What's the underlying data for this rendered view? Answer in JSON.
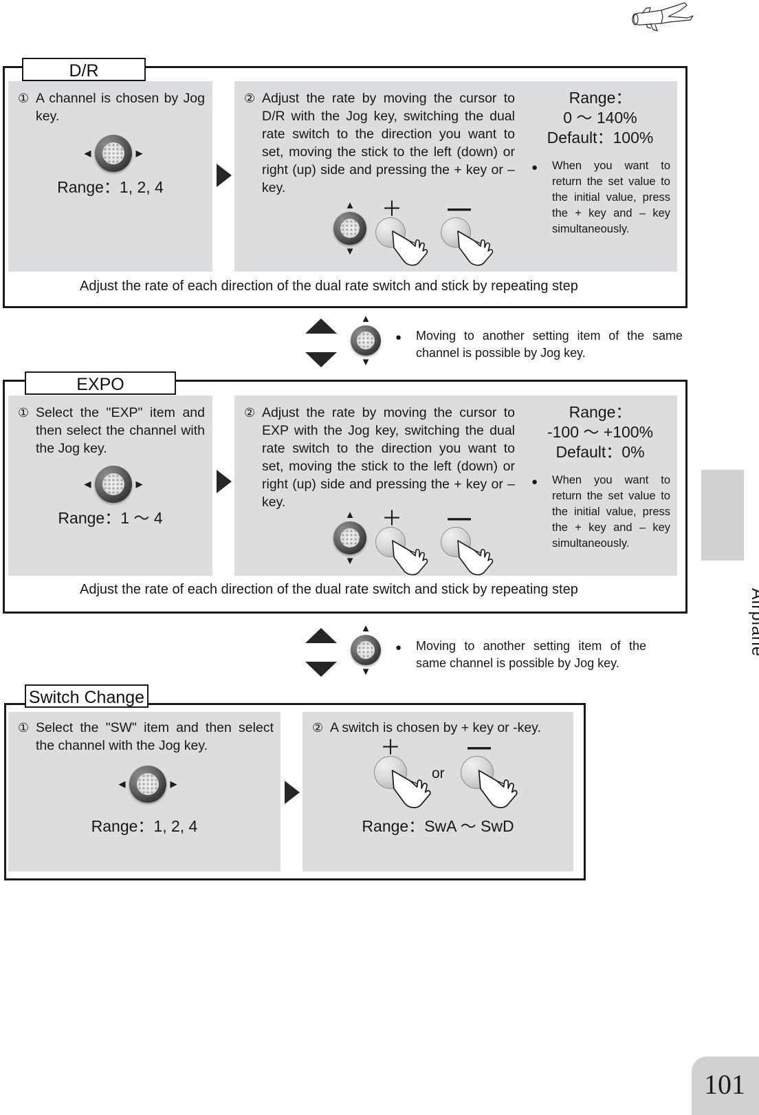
{
  "page": {
    "number": "101",
    "side_tab_label": "Airplane",
    "logo_icon": "airplane-icon"
  },
  "sections": {
    "dr": {
      "title": "D/R",
      "step1": {
        "marker": "①",
        "text": "A channel is chosen by Jog key.",
        "jog_icon": "jog-key-left-right-icon",
        "range": "Range：1, 2, 4"
      },
      "step2": {
        "marker": "②",
        "text": "Adjust the rate by moving the cursor to D/R with the Jog key, switching the dual rate switch to the direction you want to set, moving the stick to the left (down) or right (up) side and pressing the + key or – key.",
        "jog_icon": "jog-key-up-down-icon",
        "plus_key_label": "＋",
        "minus_key_label": "—"
      },
      "info": {
        "range_title": "Range：",
        "range_value": "0 ～ 140%",
        "default_value": "Default：100%",
        "bullet": "●",
        "note": "When you want to return the set value to the initial value, press the + key and – key simultaneously."
      },
      "footer": "Adjust the rate of each direction of the dual rate switch and stick by repeating step"
    },
    "connector1": {
      "up_arrow_icon": "triangle-up-icon",
      "down_arrow_icon": "triangle-down-icon",
      "jog_icon": "jog-key-up-down-icon",
      "bullet": "●",
      "note": "Moving to another setting item of the same channel is possible by Jog key."
    },
    "expo": {
      "title": "EXPO",
      "step1": {
        "marker": "①",
        "text": "Select the \"EXP\" item and then select the channel with the Jog key.",
        "jog_icon": "jog-key-left-right-icon",
        "range": "Range：1 ～ 4"
      },
      "step2": {
        "marker": "②",
        "text": "Adjust the rate by moving the cursor to EXP with the Jog key, switching the dual rate switch to the direction you want to set, moving the stick to the left (down) or right (up) side and pressing the + key or – key.",
        "jog_icon": "jog-key-up-down-icon",
        "plus_key_label": "＋",
        "minus_key_label": "—"
      },
      "info": {
        "range_title": "Range：",
        "range_value": "-100 ～ +100%",
        "default_value": "Default：0%",
        "bullet": "●",
        "note": "When you want to return the set value to the initial value, press the + key and – key simultaneously."
      },
      "footer": "Adjust the rate of each direction of the dual rate switch and stick by repeating step"
    },
    "connector2": {
      "up_arrow_icon": "triangle-up-icon",
      "down_arrow_icon": "triangle-down-icon",
      "jog_icon": "jog-key-up-down-icon",
      "bullet": "●",
      "note": "Moving to another setting item of the same channel is possible by Jog key."
    },
    "switch_change": {
      "title": "Switch Change",
      "step1": {
        "marker": "①",
        "text": "Select the \"SW\" item and then select the channel with the Jog key.",
        "jog_icon": "jog-key-left-right-icon",
        "range": "Range：1, 2, 4"
      },
      "step2": {
        "marker": "②",
        "text": "A switch is chosen by + key or -key.",
        "plus_key_label": "＋",
        "minus_key_label": "—",
        "or_label": "or",
        "range": "Range：SwA ～ SwD"
      }
    }
  },
  "colors": {
    "panel_gray": "#dcdddf",
    "tab_gray": "#d0d1d3",
    "ink": "#1a1a1a"
  }
}
